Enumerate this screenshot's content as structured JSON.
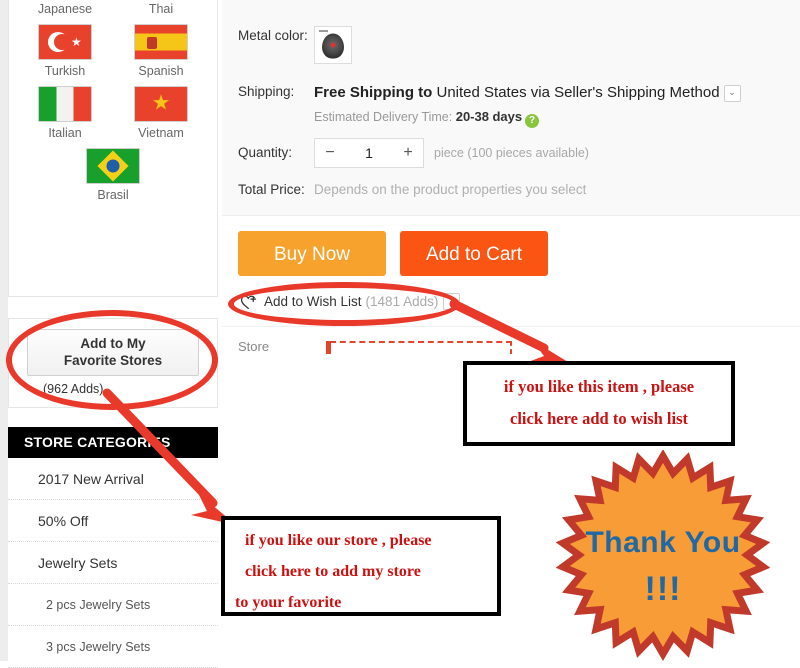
{
  "sidebar": {
    "languages": [
      {
        "label": "Japanese",
        "flag": "japanese-flag",
        "label_position": "top"
      },
      {
        "label": "Thai",
        "flag": "thai-flag",
        "label_position": "top"
      },
      {
        "label": "Turkish",
        "flag": "turkish-flag",
        "label_position": "bottom"
      },
      {
        "label": "Spanish",
        "flag": "spanish-flag",
        "label_position": "bottom"
      },
      {
        "label": "Italian",
        "flag": "italian-flag",
        "label_position": "bottom"
      },
      {
        "label": "Vietnam",
        "flag": "vietnam-flag",
        "label_position": "bottom"
      },
      {
        "label": "Brasil",
        "flag": "brasil-flag",
        "label_position": "bottom"
      }
    ],
    "favorite": {
      "button_line1": "Add to My",
      "button_line2": "Favorite Stores",
      "adds": "(962 Adds)"
    },
    "categories": {
      "header": "STORE CATEGORIES",
      "items": [
        {
          "label": "2017 New Arrival",
          "level": 0
        },
        {
          "label": "50% Off",
          "level": 0
        },
        {
          "label": "Jewelry Sets",
          "level": 0
        },
        {
          "label": "2 pcs Jewelry Sets",
          "level": 1
        },
        {
          "label": "3 pcs Jewelry Sets",
          "level": 1
        }
      ]
    }
  },
  "product": {
    "metal_color": {
      "label": "Metal color:",
      "swatch_name": "metal-color-swatch"
    },
    "shipping": {
      "label": "Shipping:",
      "bold_part": "Free Shipping to",
      "rest_part": " United States via Seller's Shipping Method",
      "caret": "⌄",
      "eta_label": "Estimated Delivery Time:",
      "eta_days": "20-38",
      "eta_unit": "days",
      "help_icon": "?"
    },
    "quantity": {
      "label": "Quantity:",
      "minus": "−",
      "value": "1",
      "plus": "+",
      "note": "piece (100 pieces available)"
    },
    "total_price": {
      "label": "Total Price:",
      "value": "Depends on the product properties you select"
    },
    "buttons": {
      "buy_now": "Buy Now",
      "add_to_cart": "Add to Cart"
    },
    "wish_list": {
      "label": "Add to Wish List",
      "count": "(1481 Adds)",
      "caret": "⌄"
    },
    "store_row": {
      "label": "Store"
    }
  },
  "annotations": {
    "wish_note": {
      "line1": "if  you like this item , please",
      "line2": "click here add to wish list"
    },
    "store_note": {
      "line1": "if  you like our store , please",
      "line2": "click here to add my store",
      "line3": "to your favorite"
    },
    "thank_you": {
      "text": "Thank You",
      "bangs": "!!!"
    }
  },
  "colors": {
    "buy_now": "#f7a22c",
    "add_to_cart": "#fb5513",
    "annotation_red": "#e8392b",
    "note_text_red": "#cc1111",
    "badge_fill": "#f79c36",
    "badge_edge": "#c0392b",
    "badge_text": "#1f6aa5",
    "category_header_bg": "#000000"
  }
}
